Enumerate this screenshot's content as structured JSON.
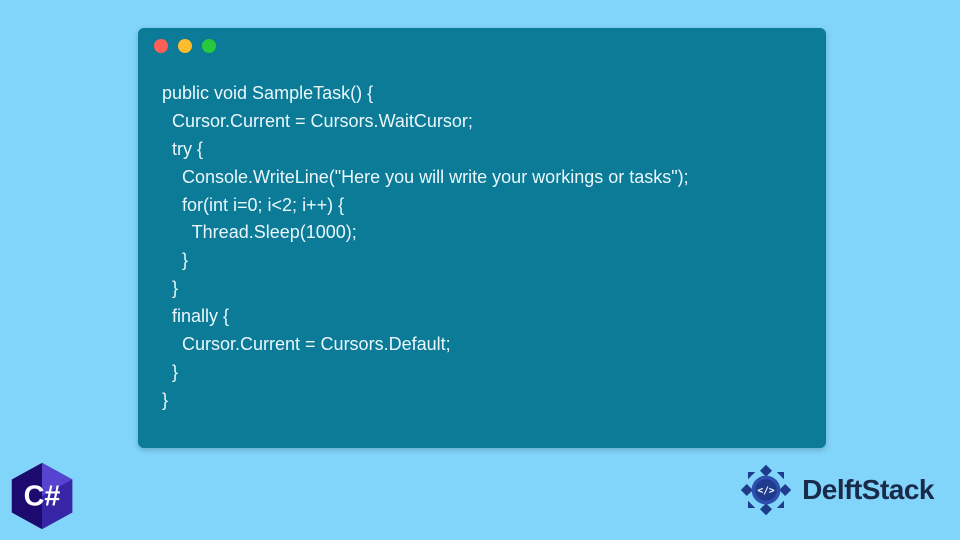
{
  "window": {
    "dots": [
      "red",
      "yellow",
      "green"
    ]
  },
  "code": {
    "lines": [
      "public void SampleTask() {",
      "  Cursor.Current = Cursors.WaitCursor;",
      "  try {",
      "    Console.WriteLine(\"Here you will write your workings or tasks\");",
      "    for(int i=0; i<2; i++) {",
      "      Thread.Sleep(1000);",
      "    }",
      "  }",
      "  finally {",
      "    Cursor.Current = Cursors.Default;",
      "  }",
      "}"
    ]
  },
  "badge": {
    "language": "C#"
  },
  "brand": {
    "name": "DelftStack",
    "tag": "</>"
  }
}
